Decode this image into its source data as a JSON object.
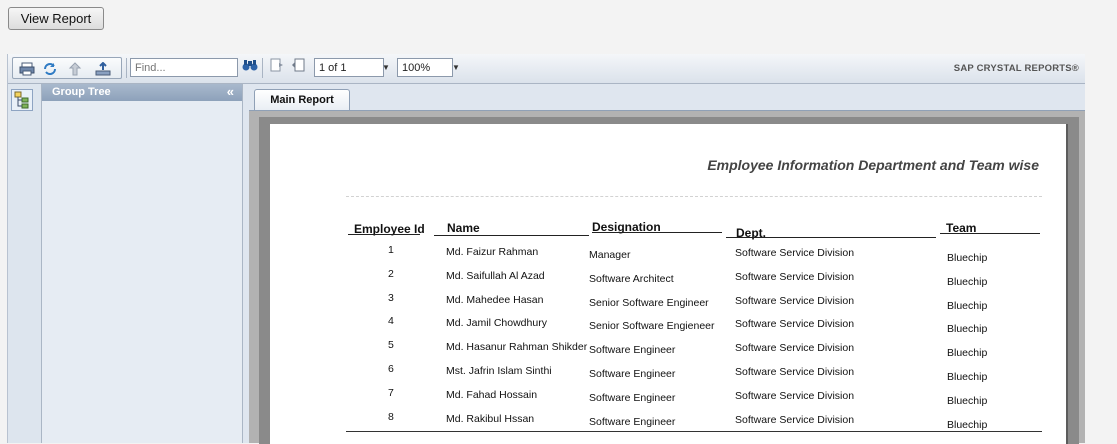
{
  "view_report_label": "View Report",
  "toolbar": {
    "find_placeholder": "Find...",
    "page_value": "1 of 1",
    "zoom_value": "100%",
    "brand": "SAP CRYSTAL REPORTS®"
  },
  "group_tree": {
    "title": "Group Tree",
    "collapse": "«"
  },
  "tab_label": "Main Report",
  "report": {
    "title": "Employee Information  Department and Team wise",
    "columns": [
      "Employee Id",
      "Name",
      "Designation",
      "Dept.",
      "Team"
    ],
    "rows": [
      {
        "id": "1",
        "name": "Md. Faizur Rahman",
        "designation": "Manager",
        "dept": "Software Service Division",
        "team": "Bluechip"
      },
      {
        "id": "2",
        "name": "Md. Saifullah Al Azad",
        "designation": "Software Architect",
        "dept": "Software Service Division",
        "team": "Bluechip"
      },
      {
        "id": "3",
        "name": "Md. Mahedee Hasan",
        "designation": "Senior Software Engineer",
        "dept": "Software Service Division",
        "team": "Bluechip"
      },
      {
        "id": "4",
        "name": "Md. Jamil Chowdhury",
        "designation": "Senior Software Engieneer",
        "dept": "Software Service Division",
        "team": "Bluechip"
      },
      {
        "id": "5",
        "name": "Md. Hasanur Rahman Shikder",
        "designation": "Software Engineer",
        "dept": "Software Service Division",
        "team": "Bluechip"
      },
      {
        "id": "6",
        "name": "Mst. Jafrin Islam Sinthi",
        "designation": "Software Engineer",
        "dept": "Software Service Division",
        "team": "Bluechip"
      },
      {
        "id": "7",
        "name": "Md. Fahad Hossain",
        "designation": "Software Engineer",
        "dept": "Software Service Division",
        "team": "Bluechip"
      },
      {
        "id": "8",
        "name": "Md. Rakibul Hssan",
        "designation": "Software Engineer",
        "dept": "Software Service Division",
        "team": "Bluechip"
      }
    ]
  }
}
